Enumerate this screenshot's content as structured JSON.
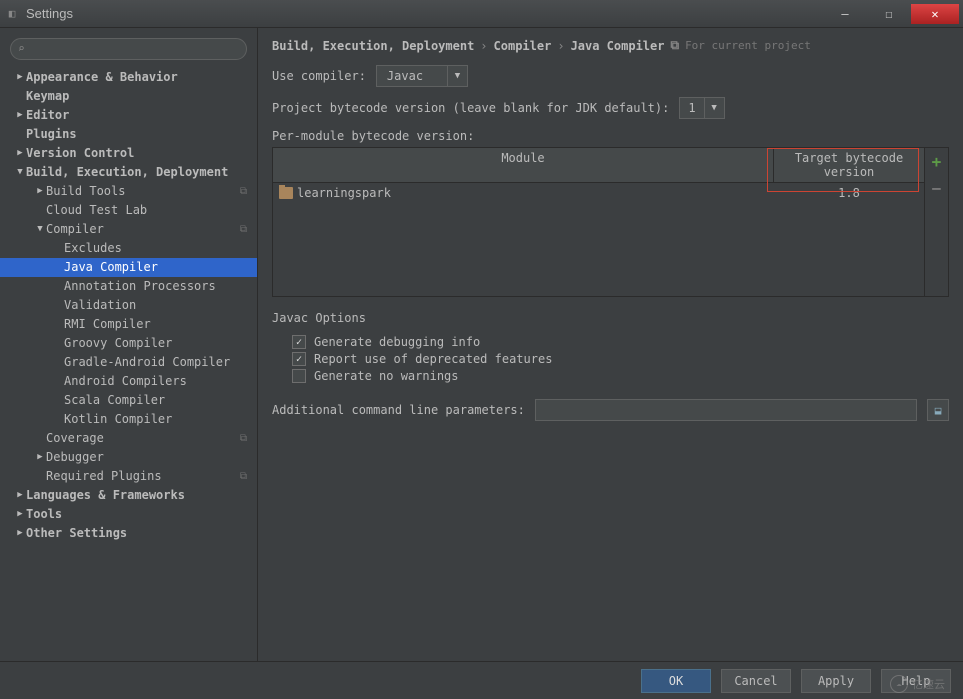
{
  "window": {
    "title": "Settings"
  },
  "sidebar": {
    "search_placeholder": "",
    "items": [
      {
        "label": "Appearance & Behavior",
        "bold": true,
        "arrow": "▶",
        "pl": 0
      },
      {
        "label": "Keymap",
        "bold": true,
        "arrow": "",
        "pl": 0
      },
      {
        "label": "Editor",
        "bold": true,
        "arrow": "▶",
        "pl": 0
      },
      {
        "label": "Plugins",
        "bold": true,
        "arrow": "",
        "pl": 0
      },
      {
        "label": "Version Control",
        "bold": true,
        "arrow": "▶",
        "pl": 0
      },
      {
        "label": "Build, Execution, Deployment",
        "bold": true,
        "arrow": "▼",
        "pl": 0
      },
      {
        "label": "Build Tools",
        "bold": false,
        "arrow": "▶",
        "pl": 1,
        "copy": true
      },
      {
        "label": "Cloud Test Lab",
        "bold": false,
        "arrow": "",
        "pl": 1
      },
      {
        "label": "Compiler",
        "bold": false,
        "arrow": "▼",
        "pl": 1,
        "copy": true
      },
      {
        "label": "Excludes",
        "bold": false,
        "arrow": "",
        "pl": 2
      },
      {
        "label": "Java Compiler",
        "bold": false,
        "arrow": "",
        "pl": 2,
        "selected": true
      },
      {
        "label": "Annotation Processors",
        "bold": false,
        "arrow": "",
        "pl": 2
      },
      {
        "label": "Validation",
        "bold": false,
        "arrow": "",
        "pl": 2
      },
      {
        "label": "RMI Compiler",
        "bold": false,
        "arrow": "",
        "pl": 2
      },
      {
        "label": "Groovy Compiler",
        "bold": false,
        "arrow": "",
        "pl": 2
      },
      {
        "label": "Gradle-Android Compiler",
        "bold": false,
        "arrow": "",
        "pl": 2
      },
      {
        "label": "Android Compilers",
        "bold": false,
        "arrow": "",
        "pl": 2
      },
      {
        "label": "Scala Compiler",
        "bold": false,
        "arrow": "",
        "pl": 2
      },
      {
        "label": "Kotlin Compiler",
        "bold": false,
        "arrow": "",
        "pl": 2
      },
      {
        "label": "Coverage",
        "bold": false,
        "arrow": "",
        "pl": 1,
        "copy": true
      },
      {
        "label": "Debugger",
        "bold": false,
        "arrow": "▶",
        "pl": 1
      },
      {
        "label": "Required Plugins",
        "bold": false,
        "arrow": "",
        "pl": 1,
        "copy": true
      },
      {
        "label": "Languages & Frameworks",
        "bold": true,
        "arrow": "▶",
        "pl": 0
      },
      {
        "label": "Tools",
        "bold": true,
        "arrow": "▶",
        "pl": 0
      },
      {
        "label": "Other Settings",
        "bold": true,
        "arrow": "▶",
        "pl": 0
      }
    ]
  },
  "breadcrumb": {
    "seg1": "Build, Execution, Deployment",
    "seg2": "Compiler",
    "seg3": "Java Compiler",
    "note": "For current project"
  },
  "main": {
    "use_compiler_label": "Use compiler:",
    "use_compiler_value": "Javac",
    "project_bytecode_label": "Project bytecode version (leave blank for JDK default):",
    "project_bytecode_value": "1",
    "per_module_label": "Per-module bytecode version:",
    "table": {
      "col_module": "Module",
      "col_target": "Target bytecode version",
      "rows": [
        {
          "module": "learningspark",
          "target": "1.8"
        }
      ]
    },
    "javac_title": "Javac Options",
    "chk_debug": "Generate debugging info",
    "chk_deprecated": "Report use of deprecated features",
    "chk_nowarn": "Generate no warnings",
    "additional_params_label": "Additional command line parameters:",
    "additional_params_value": ""
  },
  "footer": {
    "ok": "OK",
    "cancel": "Cancel",
    "apply": "Apply",
    "help": "Help"
  },
  "watermark": "亿速云"
}
